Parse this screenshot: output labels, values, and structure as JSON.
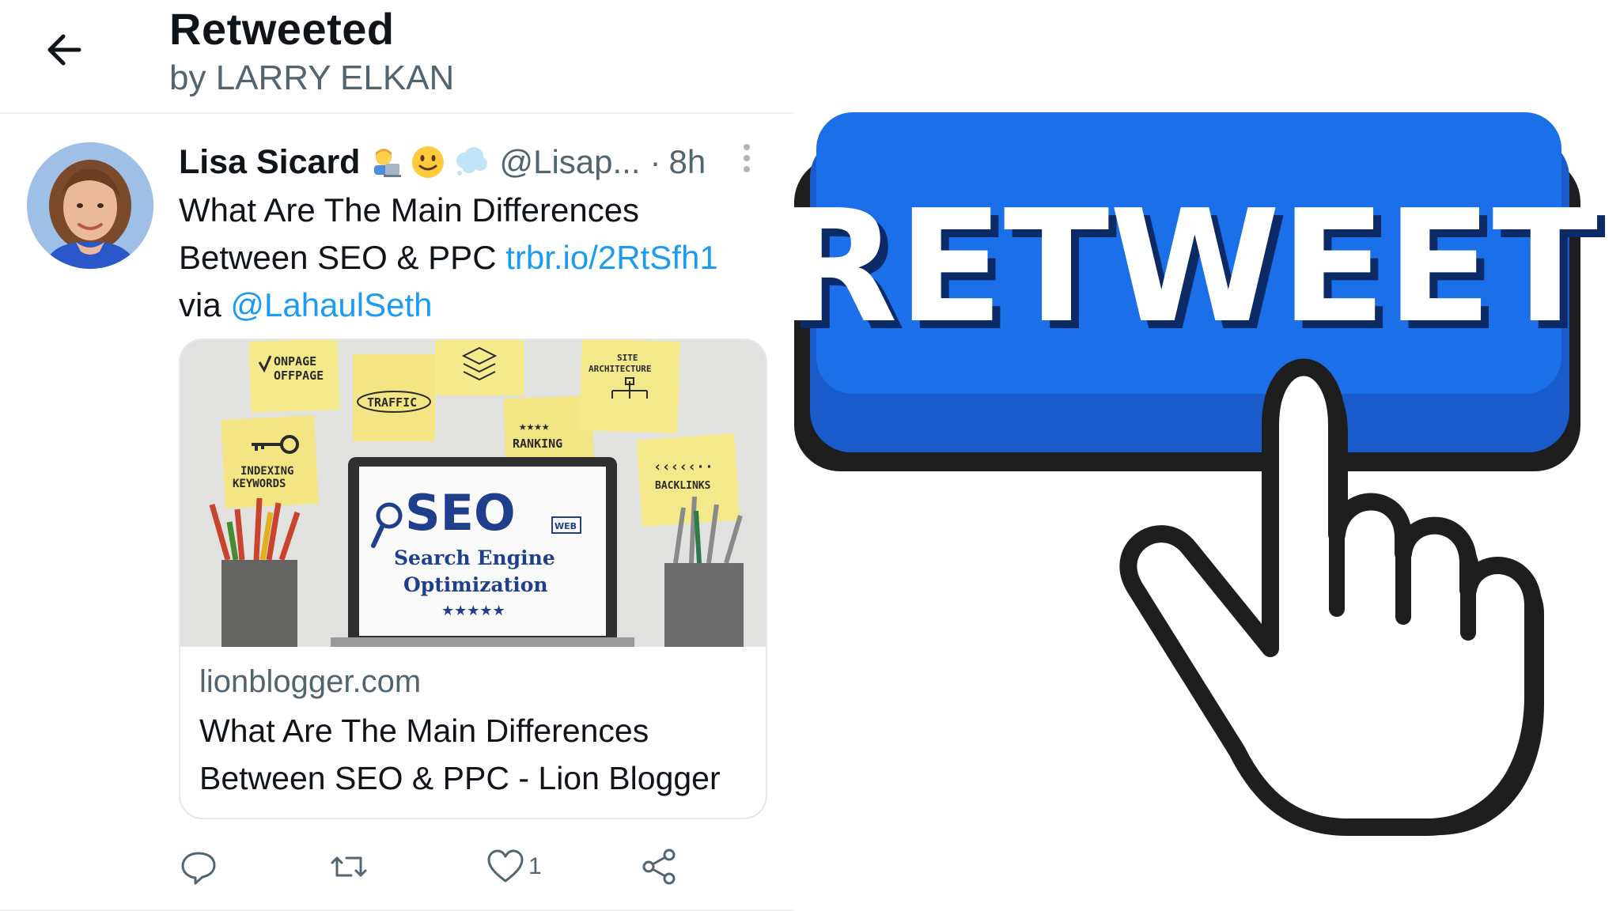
{
  "header": {
    "title": "Retweeted",
    "subtitle": "by LARRY ELKAN"
  },
  "tweet": {
    "author_name": "Lisa Sicard",
    "emojis": [
      "woman-technologist",
      "slightly-smiling-face",
      "thought-balloon"
    ],
    "handle": "@Lisap...",
    "separator": "·",
    "time": "8h",
    "text_part1": "What Are The Main Differences Between SEO & PPC ",
    "link": "trbr.io/2RtSfh1",
    "text_part2": " via ",
    "mention": "@LahaulSeth",
    "link_color": "#1d9bf0"
  },
  "card": {
    "image_notes": {
      "note1_line1": "ONPAGE",
      "note1_line2": "OFFPAGE",
      "note2": "TRAFFIC",
      "note3_line1": "SITE",
      "note3_line2": "ARCHITECTURE",
      "note4_stars": "★★★★",
      "note4": "RANKING",
      "note5_line1": "INDEXING",
      "note5_line2": "KEYWORDS",
      "note6": "BACKLINKS",
      "screen_big": "SEO",
      "screen_web": "WEB",
      "screen_line1": "Search Engine",
      "screen_line2": "Optimization",
      "screen_stars": "★★★★★"
    },
    "domain": "lionblogger.com",
    "title": "What Are The Main Differences Between SEO & PPC - Lion Blogger"
  },
  "actions": {
    "reply_icon": "speech-bubble",
    "retweet_icon": "retweet-arrows",
    "like_icon": "heart",
    "like_count": "1",
    "share_icon": "share-nodes"
  },
  "graphic": {
    "button_label": "RETWEET",
    "button_color": "#1b6fe8",
    "button_shadow_color": "#1a5bcc"
  }
}
